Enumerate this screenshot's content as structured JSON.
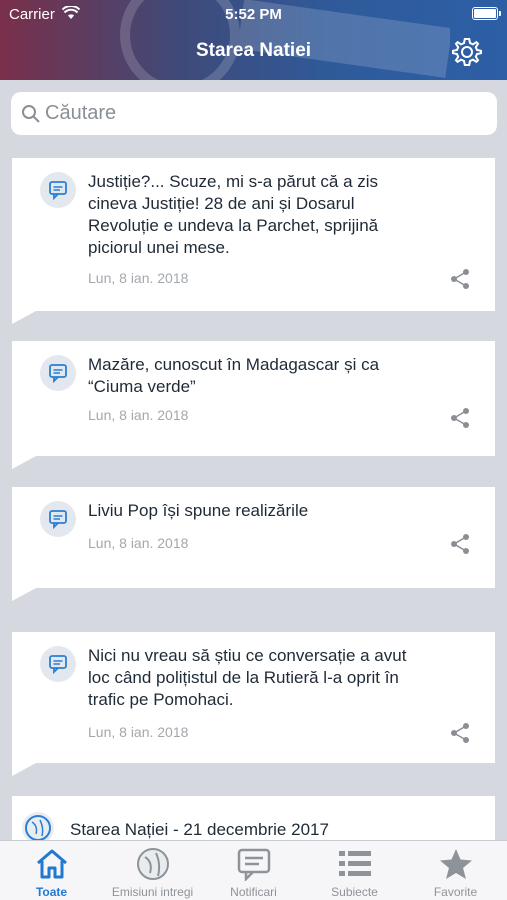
{
  "status_bar": {
    "carrier": "Carrier",
    "time": "5:52 PM"
  },
  "header": {
    "title": "Starea Natiei"
  },
  "search": {
    "placeholder": "Căutare"
  },
  "feed": [
    {
      "text": "Justiție?... Scuze, mi s-a părut că a zis cineva Justiție! 28 de ani și Dosarul Revoluție e undeva la Parchet, sprijină piciorul unei mese.",
      "date": "Lun, 8 ian. 2018"
    },
    {
      "text": "Mazăre, cunoscut în Madagascar și ca “Ciuma verde”",
      "date": "Lun, 8 ian. 2018"
    },
    {
      "text": "Liviu Pop își spune realizările",
      "date": "Lun, 8 ian. 2018"
    },
    {
      "text": "Nici nu vreau să știu ce conversație a avut loc când polițistul de la Rutieră l-a oprit în trafic pe Pomohaci.",
      "date": "Lun, 8 ian. 2018"
    }
  ],
  "episode": {
    "title": "Starea Nației - 21 decembrie 2017"
  },
  "tabs": [
    {
      "label": "Toate",
      "icon": "home-icon"
    },
    {
      "label": "Emisiuni intregi",
      "icon": "globe-icon"
    },
    {
      "label": "Notificari",
      "icon": "message-icon"
    },
    {
      "label": "Subiecte",
      "icon": "list-icon"
    },
    {
      "label": "Favorite",
      "icon": "star-icon"
    }
  ],
  "colors": {
    "accent": "#1f78d1",
    "header_start": "#7a2f4a",
    "header_end": "#2d5fa6"
  }
}
